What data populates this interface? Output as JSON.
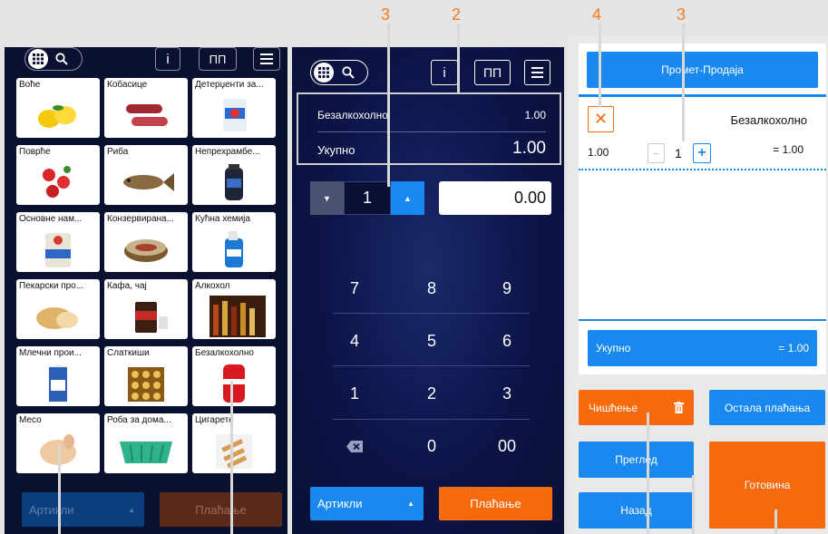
{
  "callouts": {
    "c1": "3",
    "c2": "2",
    "c3": "4",
    "c4": "3"
  },
  "colors": {
    "accent_blue": "#1989f0",
    "accent_orange": "#f86a0e",
    "callout": "#f57c1f",
    "dark_bg": "#0a1030"
  },
  "panel1": {
    "icons": {
      "grid": "grid-icon",
      "search": "search-icon",
      "info": "i",
      "pp": "ПП",
      "menu": "menu-icon"
    },
    "categories": [
      {
        "label": "Воће",
        "icon": "lemons"
      },
      {
        "label": "Кобасице",
        "icon": "sausages"
      },
      {
        "label": "Детерџенти за...",
        "icon": "detergent"
      },
      {
        "label": "Поврће",
        "icon": "strawberries"
      },
      {
        "label": "Риба",
        "icon": "fish"
      },
      {
        "label": "Непрехрамбе...",
        "icon": "shampoo"
      },
      {
        "label": "Основне нам...",
        "icon": "flour"
      },
      {
        "label": "Конзервирана...",
        "icon": "can"
      },
      {
        "label": "Кућна хемија",
        "icon": "cleaner"
      },
      {
        "label": "Пекарски про...",
        "icon": "bread"
      },
      {
        "label": "Кафа, чај",
        "icon": "coffee"
      },
      {
        "label": "Алкохол",
        "icon": "bottles"
      },
      {
        "label": "Млечни прои...",
        "icon": "milk"
      },
      {
        "label": "Слаткиши",
        "icon": "chocolates"
      },
      {
        "label": "Безалкохолно",
        "icon": "cola"
      },
      {
        "label": "Месо",
        "icon": "chicken"
      },
      {
        "label": "Роба за дома...",
        "icon": "basket"
      },
      {
        "label": "Цигарете",
        "icon": "cigarettes"
      }
    ],
    "bottom": {
      "articles": "Артикли",
      "payment": "Плаћање"
    }
  },
  "panel2": {
    "icons": {
      "grid": "grid-icon",
      "search": "search-icon",
      "info": "i",
      "pp": "ПП",
      "menu": "menu-icon"
    },
    "item": {
      "name": "Безалкохолно",
      "price": "1.00"
    },
    "total": {
      "label": "Укупно",
      "value": "1.00"
    },
    "quantity": "1",
    "amount": "0.00",
    "keypad": [
      "7",
      "8",
      "9",
      "4",
      "5",
      "6",
      "1",
      "2",
      "3",
      "⌫",
      "0",
      "00"
    ],
    "bottom": {
      "articles": "Артикли",
      "payment": "Плаћање"
    }
  },
  "panel3": {
    "header": "Промет-Продаја",
    "item": {
      "name": "Безалкохолно",
      "price": "1.00",
      "qty": "1",
      "total": "= 1.00"
    },
    "total": {
      "label": "Укупно",
      "value": "= 1.00"
    },
    "buttons": {
      "clear": "Чишћење",
      "other": "Остала плаћања",
      "review": "Преглед",
      "back": "Назад",
      "cash": "Готовина"
    }
  }
}
